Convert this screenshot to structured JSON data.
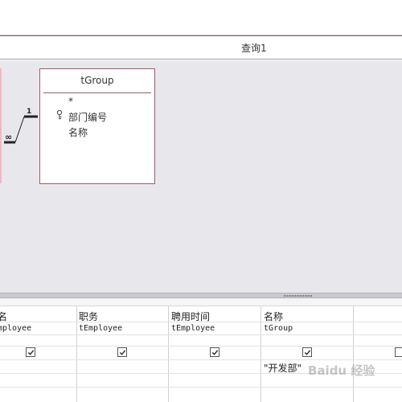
{
  "query_tab": {
    "title": "查询1"
  },
  "table": {
    "name": "tGroup",
    "fields": [
      "*",
      "部门编号",
      "名称"
    ]
  },
  "relationship": {
    "one_side": "1",
    "many_side": "∞"
  },
  "grid": {
    "columns": [
      {
        "field": "名",
        "table": "mployee",
        "show": true
      },
      {
        "field": "职务",
        "table": "tEmployee",
        "show": true
      },
      {
        "field": "聘用时间",
        "table": "tEmployee",
        "show": true
      },
      {
        "field": "名称",
        "table": "tGroup",
        "show": true,
        "criteria": "\"开发部\""
      }
    ]
  },
  "watermark": "Baidu 经验"
}
